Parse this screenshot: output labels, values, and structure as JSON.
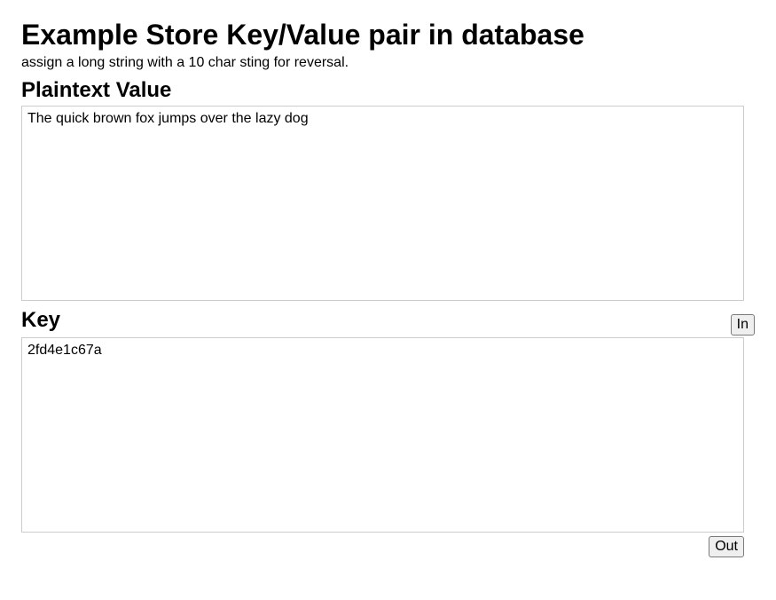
{
  "title": "Example Store Key/Value pair in database",
  "subtitle": "assign a long string with a 10 char sting for reversal.",
  "plaintext": {
    "heading": "Plaintext Value",
    "value": "The quick brown fox jumps over the lazy dog"
  },
  "key": {
    "heading": "Key",
    "value": "2fd4e1c67a"
  },
  "buttons": {
    "in": "In",
    "out": "Out"
  }
}
